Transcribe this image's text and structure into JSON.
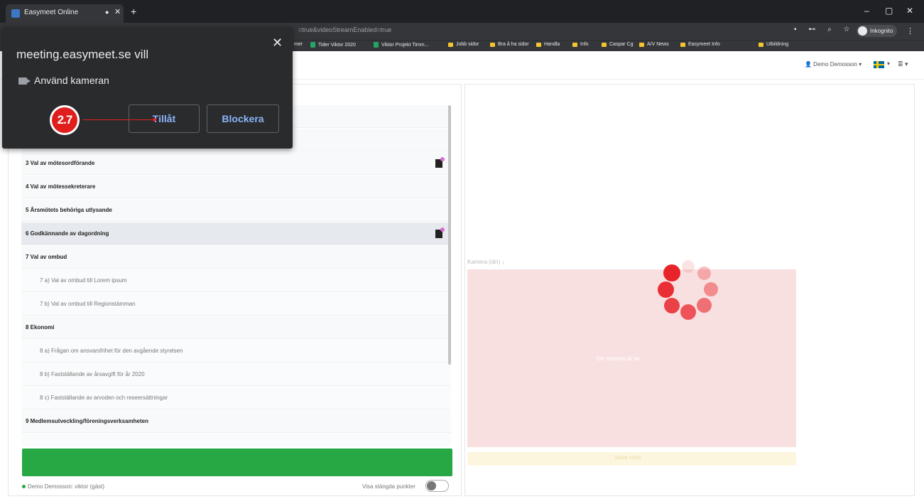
{
  "browser": {
    "tab_title": "Easymeet Online",
    "tab_dot": "●",
    "tab_close": "✕",
    "new_tab": "+",
    "window_controls": {
      "minimize": "–",
      "maximize": "▢",
      "close": "✕"
    },
    "url": "=true&videoStreamEnabled=true",
    "toolbar_icons": "▪ ⊷ ⌕ ☆",
    "incognito_label": "Inkognito",
    "menu": "⋮",
    "bookmarks": [
      {
        "label": "mer",
        "icon": "none"
      },
      {
        "label": "Tider Viktor 2020",
        "icon": "sheet"
      },
      {
        "label": "Viktor Projekt Timm...",
        "icon": "sheet"
      },
      {
        "label": "Jobb sidor",
        "icon": "folder"
      },
      {
        "label": "Bra å ha sidor",
        "icon": "folder"
      },
      {
        "label": "Handla",
        "icon": "folder"
      },
      {
        "label": "Info",
        "icon": "folder"
      },
      {
        "label": "Caspar Cg",
        "icon": "folder"
      },
      {
        "label": "A/V News",
        "icon": "folder"
      },
      {
        "label": "Easymeet Info",
        "icon": "folder"
      },
      {
        "label": "Utbildning",
        "icon": "folder"
      }
    ]
  },
  "header": {
    "user": "👤 Demo Demosson ▾",
    "flag_caret": "▾",
    "menu_icon": "≣ ▾"
  },
  "popup": {
    "title": "meeting.easymeet.se vill",
    "close": "✕",
    "permission_text": "Använd kameran",
    "allow_label": "Tillåt",
    "block_label": "Blockera",
    "marker": "2.7"
  },
  "agenda": {
    "items": [
      {
        "label": "",
        "type": "bold",
        "doc": false
      },
      {
        "label": "",
        "type": "bold",
        "doc": false
      },
      {
        "label": "3 Val av mötesordförande",
        "type": "bold",
        "doc": true
      },
      {
        "label": "4 Val av mötessekreterare",
        "type": "bold",
        "doc": false
      },
      {
        "label": "5 Årsmötets behöriga utlysande",
        "type": "bold",
        "doc": false
      },
      {
        "label": "6 Godkännande av dagordning",
        "type": "bold",
        "doc": true,
        "active": true
      },
      {
        "label": "7 Val av ombud",
        "type": "bold",
        "doc": false
      },
      {
        "label": "7 a) Val av ombud till Lorem ipsum",
        "type": "sub",
        "doc": false
      },
      {
        "label": "7 b) Val av ombud till Regionstämman",
        "type": "sub",
        "doc": false
      },
      {
        "label": "8 Ekonomi",
        "type": "bold",
        "doc": false
      },
      {
        "label": "8 a) Frågan om ansvarsfrihet för den avgående styrelsen",
        "type": "sub",
        "doc": false
      },
      {
        "label": "8 b) Fastställande av årsavgift för år 2020",
        "type": "sub",
        "doc": false
      },
      {
        "label": "8 c) Fastställande av arvoden och reseersättningar",
        "type": "sub",
        "doc": false
      },
      {
        "label": "9 Medlemsutveckling/föreningsverksamheten",
        "type": "bold",
        "doc": false
      },
      {
        "label": "",
        "type": "sub",
        "doc": false
      }
    ],
    "status": "Demo Demosson: viktor (gäst)",
    "toggle_label": "Visa stängda punkter",
    "toggle_on": false
  },
  "video": {
    "label": "Kamera (din) ↓",
    "message": "Din kamera är av",
    "yellow_text": "Starta video",
    "spinner_color": "#e8242b"
  }
}
